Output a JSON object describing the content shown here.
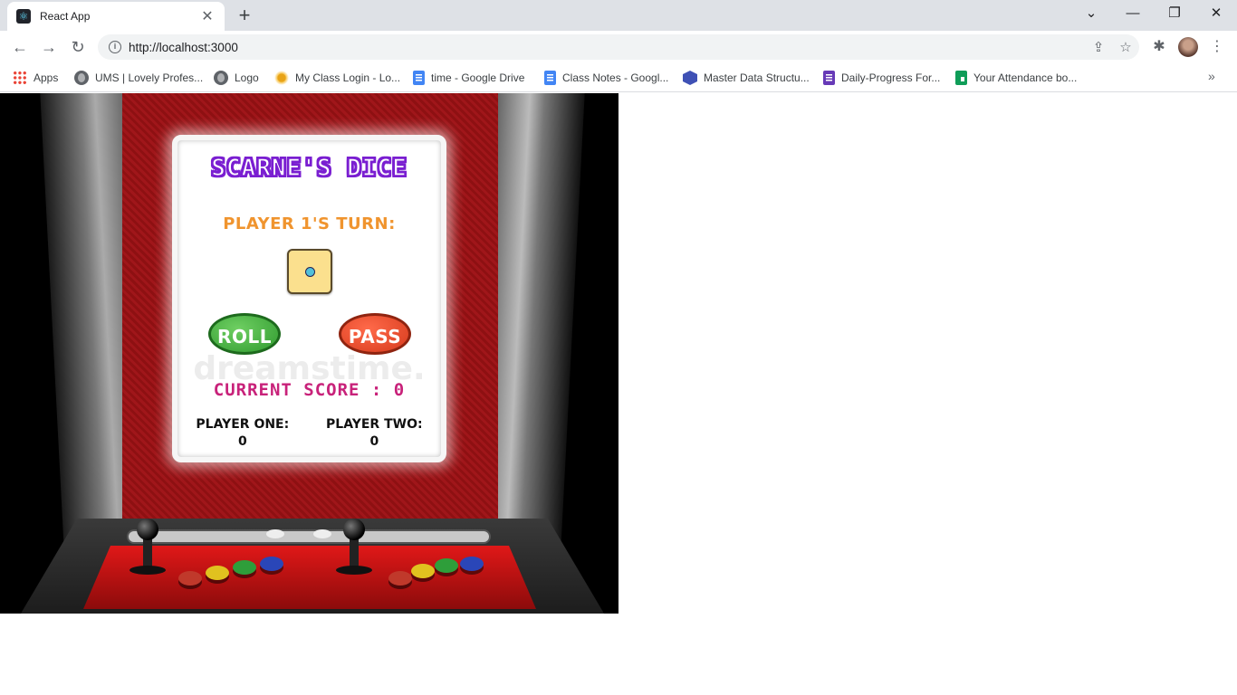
{
  "browser": {
    "tab": {
      "title": "React App",
      "favicon": "react-icon",
      "close": "✕"
    },
    "new_tab": "+",
    "window_controls": {
      "tab_search": "⌄",
      "minimize": "—",
      "restore": "❐",
      "close": "✕"
    },
    "nav": {
      "back": "←",
      "forward": "→",
      "reload": "↻"
    },
    "url": "http://localhost:3000",
    "omnibox_icons": [
      "share-icon",
      "star-icon"
    ],
    "bookmarks": [
      {
        "label": "Apps",
        "icon": "apps-grid-icon"
      },
      {
        "label": "UMS | Lovely Profes...",
        "icon": "globe-icon"
      },
      {
        "label": "Logo",
        "icon": "globe-icon"
      },
      {
        "label": "My Class Login - Lo...",
        "icon": "sun-icon"
      },
      {
        "label": "time - Google Drive",
        "icon": "docs-icon"
      },
      {
        "label": "Class Notes - Googl...",
        "icon": "docs-icon"
      },
      {
        "label": "Master Data Structu...",
        "icon": "hexagon-icon"
      },
      {
        "label": "Daily-Progress For...",
        "icon": "forms-icon"
      },
      {
        "label": "Your Attendance bo...",
        "icon": "sheets-icon"
      }
    ],
    "bookmarks_overflow": "»"
  },
  "game": {
    "title": "SCARNE'S DICE",
    "turn": "PLAYER 1'S TURN:",
    "die_value": 1,
    "roll_label": "ROLL",
    "pass_label": "PASS",
    "current_score_label": "CURRENT SCORE : 0",
    "player_one_label": "PLAYER ONE:",
    "player_one_score": "0",
    "player_two_label": "PLAYER TWO:",
    "player_two_score": "0",
    "watermark": "dreamstime."
  },
  "colors": {
    "title": "#7a1fd1",
    "turn": "#f0942e",
    "score": "#c8227a",
    "roll": "#3fa83a",
    "pass": "#e8452a",
    "die": "#fbe08e"
  }
}
